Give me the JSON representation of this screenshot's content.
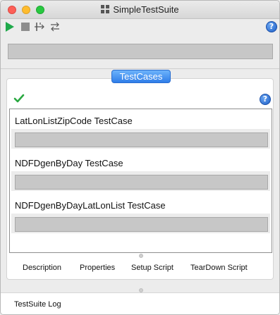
{
  "window": {
    "title": "SimpleTestSuite"
  },
  "toolbar": {
    "icons": [
      "run-icon",
      "stop-icon",
      "add-testcase-icon",
      "swap-icon"
    ],
    "help_label": "?"
  },
  "testcases_panel": {
    "header_button": "TestCases",
    "status_icon": "check-icon",
    "help_label": "?",
    "items": [
      {
        "name": "LatLonListZipCode TestCase"
      },
      {
        "name": "NDFDgenByDay TestCase"
      },
      {
        "name": "NDFDgenByDayLatLonList TestCase"
      }
    ],
    "tabs": [
      "Description",
      "Properties",
      "Setup Script",
      "TearDown Script"
    ]
  },
  "log": {
    "label": "TestSuite Log"
  },
  "colors": {
    "accent": "#2f7de8",
    "run_green": "#1fa94a",
    "check_green": "#2aa841",
    "progress_grey": "#c7c7c7"
  }
}
